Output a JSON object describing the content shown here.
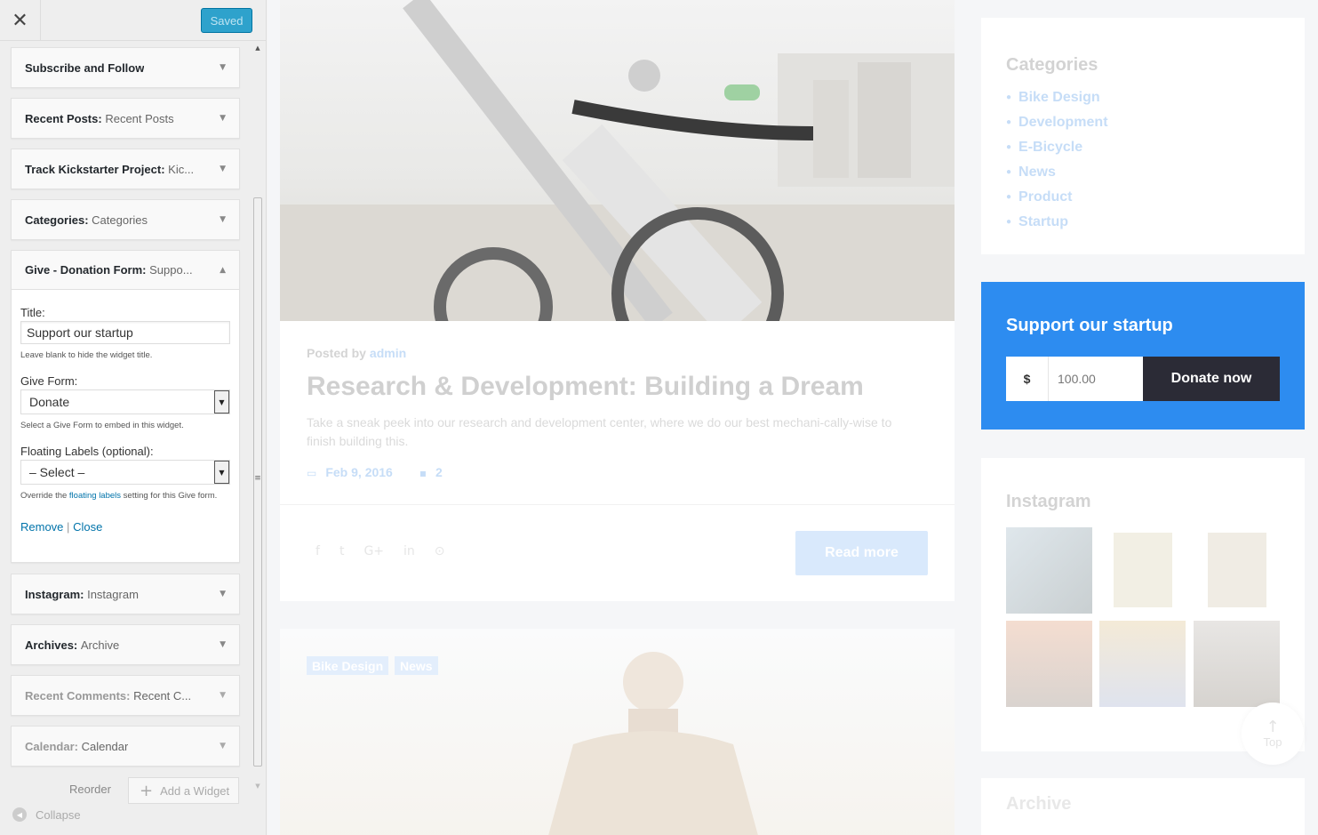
{
  "topbar": {
    "close_glyph": "✕",
    "saved_label": "Saved"
  },
  "widgets": [
    {
      "name": "Subscribe and Follow",
      "sub": ""
    },
    {
      "name": "Recent Posts",
      "sub": "Recent Posts"
    },
    {
      "name": "Track Kickstarter Project",
      "sub": "Kic..."
    },
    {
      "name": "Categories",
      "sub": "Categories"
    },
    {
      "name": "Give - Donation Form",
      "sub": "Suppo..."
    },
    {
      "name": "Instagram",
      "sub": "Instagram"
    },
    {
      "name": "Archives",
      "sub": "Archive"
    },
    {
      "name": "Recent Comments",
      "sub": "Recent C..."
    },
    {
      "name": "Calendar",
      "sub": "Calendar"
    }
  ],
  "give_form_widget": {
    "title_label": "Title:",
    "title_value": "Support our startup",
    "title_help": "Leave blank to hide the widget title.",
    "form_label": "Give Form:",
    "form_value": "Donate",
    "form_help": "Select a Give Form to embed in this widget.",
    "floating_label": "Floating Labels (optional):",
    "floating_value": "– Select –",
    "floating_help_pre": "Override the",
    "floating_help_link": "floating labels",
    "floating_help_post": "setting for this Give form.",
    "remove_label": "Remove",
    "separator": "|",
    "close_label": "Close"
  },
  "footer": {
    "reorder_label": "Reorder",
    "add_widget_label": "Add a Widget",
    "collapse_label": "Collapse"
  },
  "preview": {
    "post": {
      "posted_by": "Posted by",
      "author": "admin",
      "title": "Research & Development: Building a Dream",
      "excerpt": "Take a sneak peek into our research and development center, where we do our best mechani-cally-wise to finish building this.",
      "date": "Feb 9, 2016",
      "comments": "2",
      "read_more": "Read more"
    },
    "post2_tags": [
      "Bike Design",
      "News"
    ],
    "categories": {
      "title": "Categories",
      "items": [
        "Bike Design",
        "Development",
        "E-Bicycle",
        "News",
        "Product",
        "Startup"
      ]
    },
    "donate": {
      "title": "Support our startup",
      "currency": "$",
      "amount": "100.00",
      "button": "Donate now"
    },
    "instagram": {
      "title": "Instagram"
    },
    "top_label": "Top",
    "archive": {
      "title": "Archive"
    }
  },
  "colors": {
    "accent": "#2d8cf0",
    "saved_button": "#2ea2cc",
    "donate_button": "#2b2b36",
    "link": "#0073aa"
  }
}
